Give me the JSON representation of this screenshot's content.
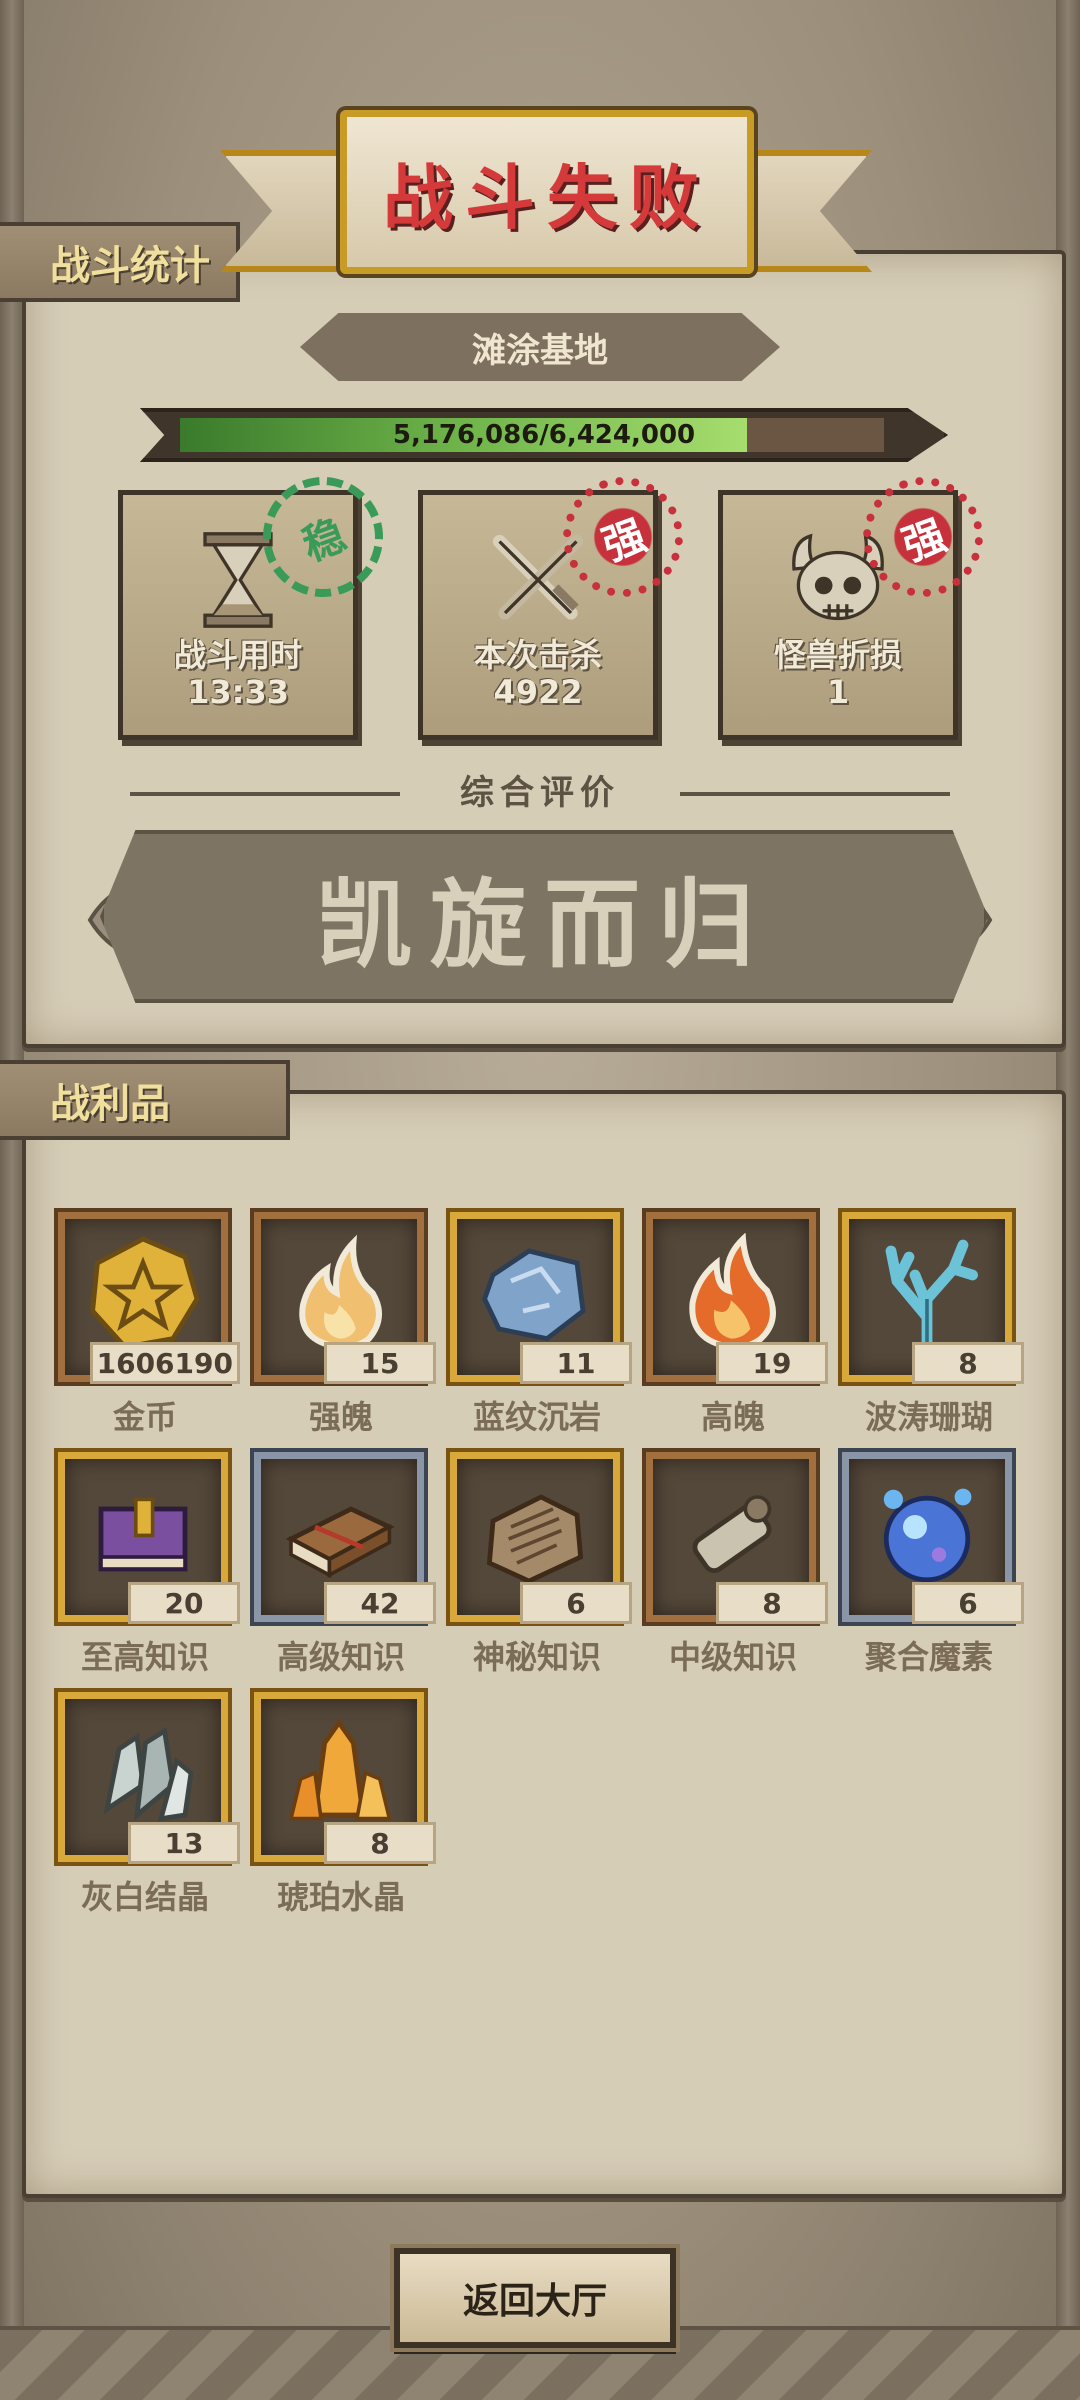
{
  "header": {
    "title": "战斗失败"
  },
  "tabs": {
    "stats": "战斗统计",
    "loot": "战利品"
  },
  "location": "滩涂基地",
  "progress": {
    "text": "5,176,086/6,424,000",
    "fraction": 0.806
  },
  "stats": [
    {
      "label": "战斗用时",
      "value": "13:33",
      "stamp": "稳",
      "stamp_color": "#3a9a57",
      "icon": "hourglass-icon"
    },
    {
      "label": "本次击杀",
      "value": "4922",
      "stamp": "强",
      "stamp_color": "#c7313b",
      "icon": "crossed-swords-icon"
    },
    {
      "label": "怪兽折损",
      "value": "1",
      "stamp": "强",
      "stamp_color": "#c7313b",
      "icon": "horned-skull-icon"
    }
  ],
  "rating": {
    "label": "综合评价",
    "text": "凯旋而归"
  },
  "loot": [
    {
      "name": "金币",
      "count": "1606190",
      "frame": "bronze",
      "icon": "gold-coin-icon"
    },
    {
      "name": "强魄",
      "count": "15",
      "frame": "bronze",
      "icon": "flame-spirit-icon"
    },
    {
      "name": "蓝纹沉岩",
      "count": "11",
      "frame": "gold",
      "icon": "blue-rock-icon"
    },
    {
      "name": "高魄",
      "count": "19",
      "frame": "bronze",
      "icon": "orange-flame-icon"
    },
    {
      "name": "波涛珊瑚",
      "count": "8",
      "frame": "gold",
      "icon": "coral-icon"
    },
    {
      "name": "至高知识",
      "count": "20",
      "frame": "gold",
      "icon": "purple-book-icon"
    },
    {
      "name": "高级知识",
      "count": "42",
      "frame": "silver",
      "icon": "brown-book-icon"
    },
    {
      "name": "神秘知识",
      "count": "6",
      "frame": "gold",
      "icon": "stone-tablet-icon"
    },
    {
      "name": "中级知识",
      "count": "8",
      "frame": "bronze",
      "icon": "scroll-icon"
    },
    {
      "name": "聚合魔素",
      "count": "6",
      "frame": "silver",
      "icon": "blue-orb-icon"
    },
    {
      "name": "灰白结晶",
      "count": "13",
      "frame": "gold",
      "icon": "gray-crystal-icon"
    },
    {
      "name": "琥珀水晶",
      "count": "8",
      "frame": "gold",
      "icon": "amber-crystal-icon"
    }
  ],
  "buttons": {
    "back": "返回大厅"
  }
}
